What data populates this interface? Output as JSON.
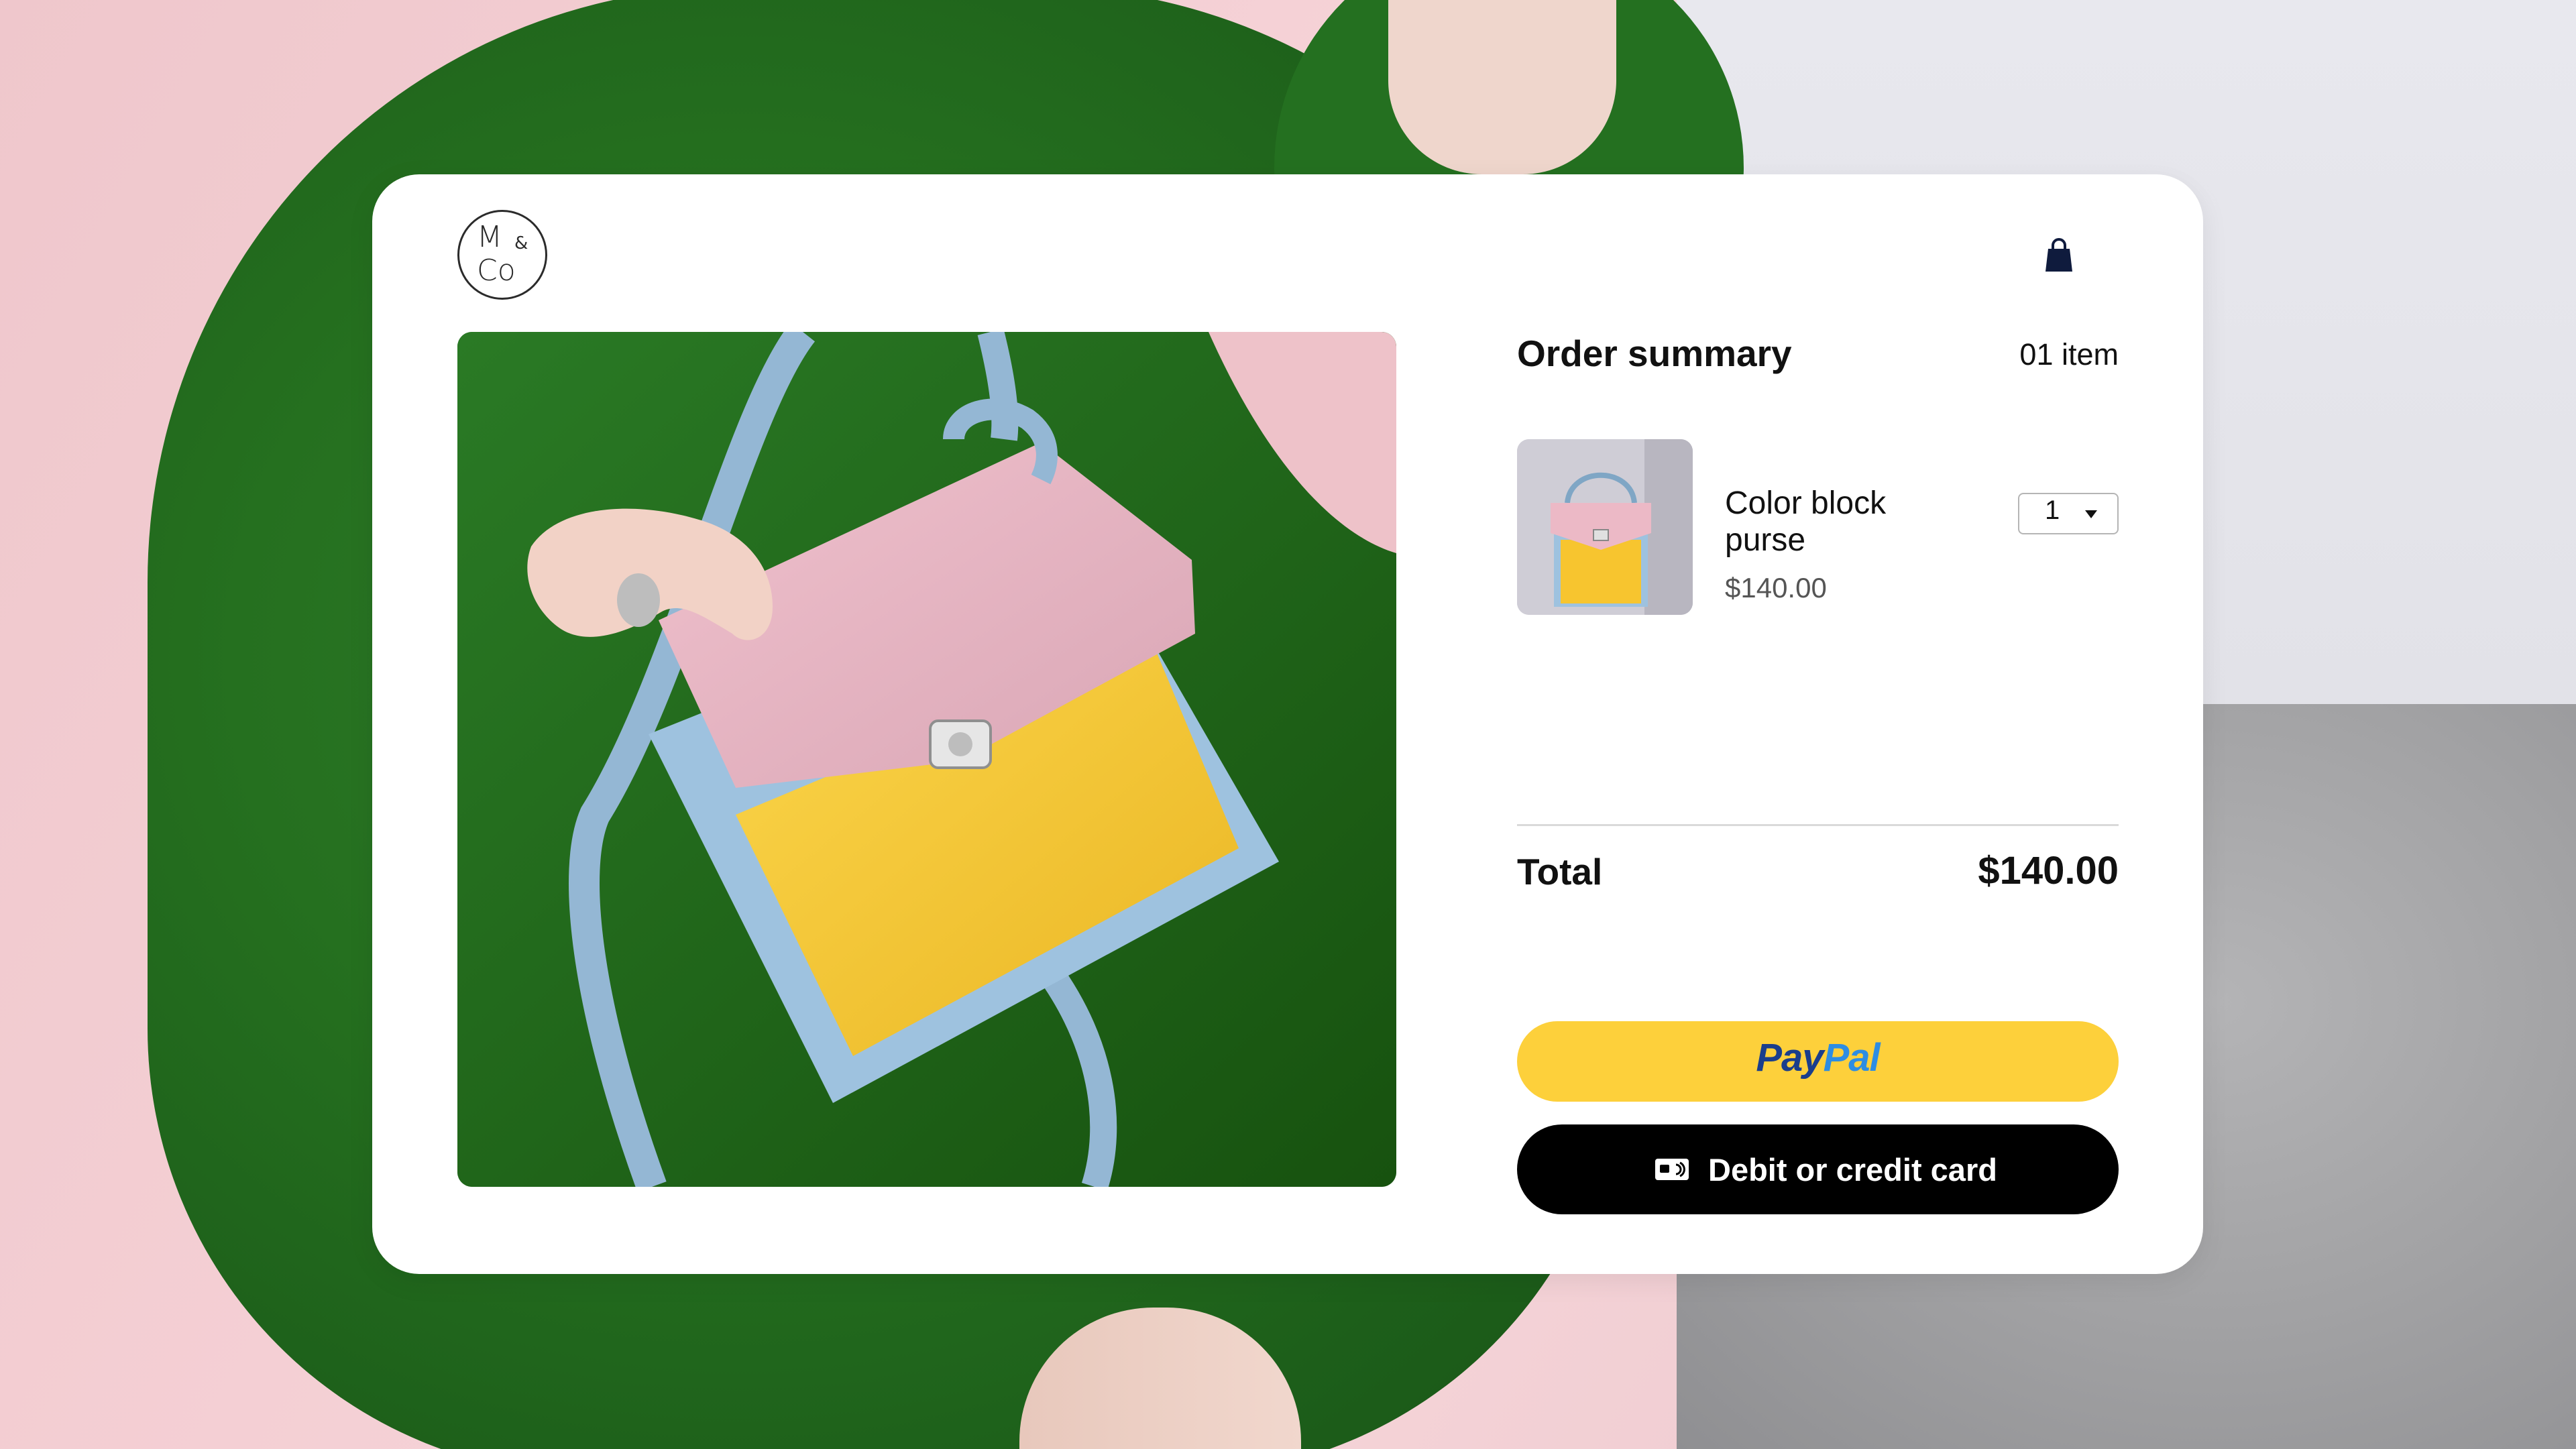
{
  "brand": {
    "logo_line1": "M",
    "logo_amp": "&",
    "logo_line2": "Co",
    "icon": "cart-bag-icon"
  },
  "order_summary": {
    "title": "Order summary",
    "item_count": "01 item",
    "items": [
      {
        "name": "Color block purse",
        "price": "$140.00",
        "quantity": "1"
      }
    ],
    "total_label": "Total",
    "total_value": "$140.00"
  },
  "payment": {
    "paypal_label_pay": "Pay",
    "paypal_label_pal": "Pal",
    "card_label": "Debit or credit card",
    "card_icon": "credit-card-icon"
  },
  "colors": {
    "paypal_yellow": "#fdd03b",
    "paypal_dark_blue": "#1a3e8c",
    "paypal_light_blue": "#2d8de3",
    "card_button": "#000000",
    "cart_icon": "#0f1b3d",
    "purse_pink": "#e9b6c3",
    "purse_yellow": "#f7c52f",
    "purse_blue": "#9ec2df",
    "suit_green": "#25701f"
  }
}
